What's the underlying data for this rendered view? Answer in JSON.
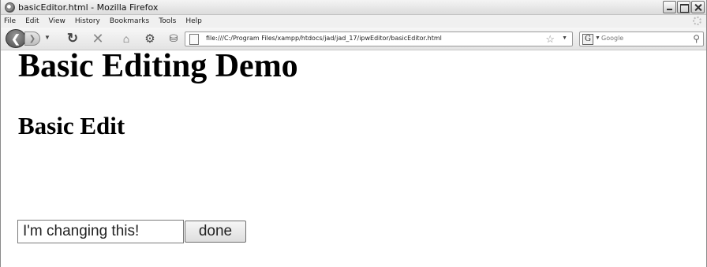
{
  "window": {
    "title": "basicEditor.html - Mozilla Firefox"
  },
  "menu": {
    "items": [
      "File",
      "Edit",
      "View",
      "History",
      "Bookmarks",
      "Tools",
      "Help"
    ]
  },
  "toolbar": {
    "url": "file:///C:/Program Files/xampp/htdocs/jad/jad_17/ipwEditor/basicEditor.html",
    "search_placeholder": "Google"
  },
  "page": {
    "heading": "Basic Editing Demo",
    "subheading": "Basic Edit",
    "input_value": "I'm changing this!",
    "done_label": "done"
  },
  "icons": {
    "back": "back-arrow-icon",
    "forward": "forward-arrow-icon",
    "reload": "reload-icon",
    "stop": "stop-icon",
    "home": "home-icon",
    "addon": "gear-icon",
    "database": "database-icon",
    "bookmark": "star-icon",
    "search": "search-icon"
  }
}
